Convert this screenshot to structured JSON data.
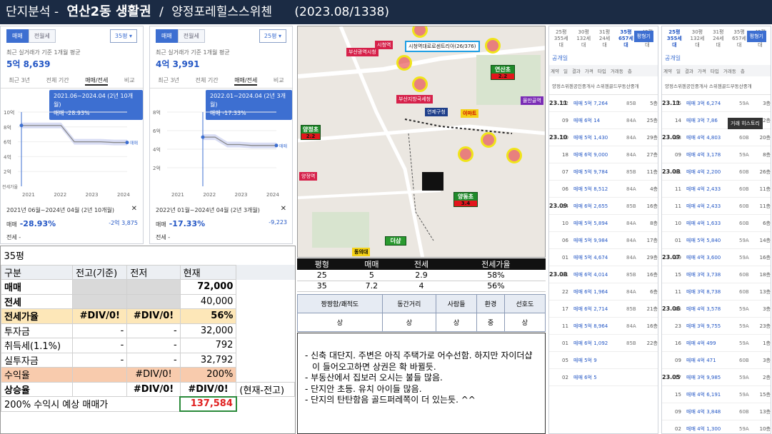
{
  "title": {
    "part1": "단지분석 -",
    "dong": "연산2동 생활권",
    "slash": "/",
    "complex": "양정포레힐스스위첸",
    "period": "(2023.08/1338)"
  },
  "cards": [
    {
      "tab1": "매매",
      "tab2": "전월세",
      "pyeong": "35평",
      "basis": "최근 실거래가 기준 1개월 평균",
      "price": "5억 8,639",
      "ptabs": [
        "최근 3년",
        "전체 기간",
        "매매/전세",
        "비교"
      ],
      "tip_line1": "2021.06~2024.04 (2년 10개월)",
      "tip_line2": "매매 -28.93%",
      "yticks": [
        "10억",
        "8억",
        "6억",
        "4억",
        "2억"
      ],
      "xticks": [
        "2021",
        "2022",
        "2023",
        "2024"
      ],
      "legend": "매매",
      "axis_note": "전세가율",
      "period": "2021년 06월~2024년 04월 (2년 10개월)",
      "close": "✕",
      "sale_label": "매매",
      "sale_pct": "-28.93%",
      "sale_amt": "-2억 3,875",
      "jeonse_label": "전세",
      "jeonse_val": "-"
    },
    {
      "tab1": "매매",
      "tab2": "전월세",
      "pyeong": "25평",
      "basis": "최근 실거래가 기준 1개월 평균",
      "price": "4억 3,991",
      "ptabs": [
        "최근 3년",
        "전체 기간",
        "매매/전세",
        "비교"
      ],
      "tip_line1": "2022.01~2024.04 (2년 3개월)",
      "tip_line2": "매매 -17.33%",
      "yticks": [
        "8억",
        "6억",
        "4억",
        "2억"
      ],
      "xticks": [
        "2021",
        "2022",
        "2023",
        "2024"
      ],
      "legend": "매매",
      "axis_note": "",
      "period": "2022년 01월~2024년 04월 (2년 3개월)",
      "close": "✕",
      "sale_label": "매매",
      "sale_pct": "-17.33%",
      "sale_amt": "-9,223",
      "jeonse_label": "전세",
      "jeonse_val": "-"
    }
  ],
  "chart_data": [
    {
      "type": "line",
      "title": "",
      "xlabel": "",
      "ylabel": "",
      "x": [
        "2021.06",
        "2021.09",
        "2022.01",
        "2022.06",
        "2022.09",
        "2023.01",
        "2023.06",
        "2024.01",
        "2024.04"
      ],
      "series": [
        {
          "name": "매매",
          "values": [
            8.2,
            8.2,
            8.2,
            8.2,
            6.0,
            6.0,
            6.0,
            5.9,
            5.9
          ]
        }
      ],
      "ylim": [
        0,
        10
      ]
    },
    {
      "type": "line",
      "title": "",
      "xlabel": "",
      "ylabel": "",
      "x": [
        "2022.01",
        "2022.06",
        "2022.09",
        "2023.01",
        "2023.06",
        "2024.01",
        "2024.04"
      ],
      "series": [
        {
          "name": "매매",
          "values": [
            5.3,
            5.3,
            4.5,
            4.5,
            4.4,
            4.4,
            4.4
          ]
        }
      ],
      "ylim": [
        0,
        8
      ]
    }
  ],
  "map": {
    "labels": [
      "시청역",
      "시청역대로로센트리아(26/376)",
      "부산광역시청",
      "부산지방국세청",
      "연제구청",
      "이마트",
      "연산초",
      "물만골역",
      "양정초",
      "양정역",
      "양동초",
      "동의대",
      "더샵"
    ],
    "green_sub": [
      "2.2",
      "2.2",
      "3.4"
    ]
  },
  "calc": {
    "pyeong": "35평",
    "headers": [
      "구분",
      "전고(기준)",
      "전저",
      "현재"
    ],
    "rows": [
      {
        "label": "매매",
        "c1": "",
        "c2": "",
        "c3": "72,000"
      },
      {
        "label": "전세",
        "c1": "",
        "c2": "",
        "c3": "40,000"
      },
      {
        "label": "전세가율",
        "c1": "#DIV/0!",
        "c2": "#DIV/0!",
        "c3": "56%"
      },
      {
        "label": "투자금",
        "c1": "-",
        "c2": "-",
        "c3": "32,000"
      },
      {
        "label": "취득세(1.1%)",
        "c1": "-",
        "c2": "-",
        "c3": "792"
      },
      {
        "label": "실투자금",
        "c1": "-",
        "c2": "-",
        "c3": "32,792"
      },
      {
        "label": "수익율",
        "c1": "",
        "c2": "#DIV/0!",
        "c3": "200%"
      },
      {
        "label": "상승율",
        "c1": "",
        "c2": "#DIV/0!",
        "c3": "#DIV/0!",
        "note": "(현재-전고)"
      }
    ],
    "target_label": "200% 수익시 예상 매매가",
    "target_value": "137,584"
  },
  "summary": {
    "headers": [
      "평형",
      "매매",
      "전세",
      "전세가율"
    ],
    "rows": [
      [
        "25",
        "5",
        "2.9",
        "58%"
      ],
      [
        "35",
        "7.2",
        "4",
        "56%"
      ]
    ]
  },
  "ratings": {
    "headers": [
      "짱짱함/쾌적도",
      "동간거리",
      "사람들",
      "환경",
      "선호도"
    ],
    "values": [
      "상",
      "상",
      "상",
      "중",
      "상"
    ]
  },
  "notes": [
    "- 신축 대단지. 주변은 아직 주택가로 어수선함. 하지만 자이더샵이 들어오고하면 상권은 확 바뀔듯.",
    "- 부동산에서 집보러 오시는 불들 많음.",
    "- 단지안 초등. 유치 아이들 많음.",
    "- 단지의 탄탄함음 골드퍼레쪽이 더 있는듯. ^^"
  ],
  "trades_a": {
    "tabs": [
      {
        "p": "25평",
        "n": "355세대"
      },
      {
        "p": "30평",
        "n": "132세대"
      },
      {
        "p": "31평",
        "n": "24세대"
      },
      {
        "p": "35평",
        "n": "657세대"
      },
      {
        "p": "42평",
        "n": "84세대"
      }
    ],
    "button": "평형기",
    "sub": "공개일",
    "cols": [
      "계약",
      "일",
      "결과",
      "가격",
      "타입",
      "거래동",
      "층"
    ],
    "agents": "양정스위첸공인중개사  스위첸골드부동산중개",
    "rows": [
      {
        "d": "23.11",
        "dd": "12",
        "p": "매매 5억 7,264",
        "t": "85B",
        "f": "5층"
      },
      {
        "d": "",
        "dd": "09",
        "p": "매매 6억 14",
        "t": "84A",
        "f": "25층"
      },
      {
        "d": "23.10",
        "dd": "30",
        "p": "매매 5억 1,430",
        "t": "84A",
        "f": "29층"
      },
      {
        "d": "",
        "dd": "18",
        "p": "매매 6억 9,000",
        "t": "84A",
        "f": "27층"
      },
      {
        "d": "",
        "dd": "07",
        "p": "매매 5억 9,784",
        "t": "85B",
        "f": "11층"
      },
      {
        "d": "",
        "dd": "06",
        "p": "매매 5억 8,512",
        "t": "84A",
        "f": "4층"
      },
      {
        "d": "23.09",
        "dd": "14",
        "p": "매매 6억 2,655",
        "t": "85B",
        "f": "16층"
      },
      {
        "d": "",
        "dd": "10",
        "p": "매매 5억 5,894",
        "t": "84A",
        "f": "8층"
      },
      {
        "d": "",
        "dd": "06",
        "p": "매매 5억 9,984",
        "t": "84A",
        "f": "17층"
      },
      {
        "d": "",
        "dd": "01",
        "p": "매매 5억 4,674",
        "t": "84A",
        "f": "29층"
      },
      {
        "d": "23.08",
        "dd": "31",
        "p": "매매 6억 4,014",
        "t": "85B",
        "f": "16층"
      },
      {
        "d": "",
        "dd": "22",
        "p": "매매 6억 1,964",
        "t": "84A",
        "f": "6층"
      },
      {
        "d": "",
        "dd": "17",
        "p": "매매 6억 2,714",
        "t": "85B",
        "f": "21층"
      },
      {
        "d": "",
        "dd": "11",
        "p": "매매 5억 8,964",
        "t": "84A",
        "f": "16층"
      },
      {
        "d": "",
        "dd": "01",
        "p": "매매 6억 1,092",
        "t": "85B",
        "f": "22층"
      },
      {
        "d": "",
        "dd": "05",
        "p": "매매 5억 9",
        "t": "",
        "f": ""
      },
      {
        "d": "",
        "dd": "02",
        "p": "매매 6억 5",
        "t": "",
        "f": ""
      }
    ]
  },
  "trades_b": {
    "tabs": [
      {
        "p": "25평",
        "n": "355세대"
      },
      {
        "p": "30평",
        "n": "132세대"
      },
      {
        "p": "31평",
        "n": "24세대"
      },
      {
        "p": "35평",
        "n": "657세대"
      },
      {
        "p": "42평",
        "n": "84세대"
      }
    ],
    "button": "평형기",
    "sub": "공개일",
    "cols": [
      "계약",
      "일",
      "결과",
      "가격",
      "타입",
      "거래동",
      "층"
    ],
    "agents": "양정스위첸공인중개사  스위첸골드부동산중개",
    "tooltip": "거래 히스토리",
    "rows": [
      {
        "d": "23.11",
        "dd": "15",
        "p": "매매 3억 6,274",
        "t": "59A",
        "f": "3층"
      },
      {
        "d": "",
        "dd": "14",
        "p": "매매 3억 7,86",
        "t": "",
        "f": "2층"
      },
      {
        "d": "23.09",
        "dd": "23",
        "p": "매매 4억 4,803",
        "t": "60B",
        "f": "20층"
      },
      {
        "d": "",
        "dd": "09",
        "p": "매매 4억 3,178",
        "t": "59A",
        "f": "8층"
      },
      {
        "d": "23.08",
        "dd": "31",
        "p": "매매 4억 2,200",
        "t": "60B",
        "f": "26층"
      },
      {
        "d": "",
        "dd": "11",
        "p": "매매 4억 2,433",
        "t": "60B",
        "f": "11층"
      },
      {
        "d": "",
        "dd": "11",
        "p": "매매 4억 2,433",
        "t": "60B",
        "f": "11층"
      },
      {
        "d": "",
        "dd": "10",
        "p": "매매 4억 1,633",
        "t": "60B",
        "f": "6층"
      },
      {
        "d": "",
        "dd": "01",
        "p": "매매 5억 5,840",
        "t": "59A",
        "f": "14층"
      },
      {
        "d": "23.07",
        "dd": "29",
        "p": "매매 4억 3,600",
        "t": "59A",
        "f": "16층"
      },
      {
        "d": "",
        "dd": "15",
        "p": "매매 3억 3,738",
        "t": "60B",
        "f": "18층"
      },
      {
        "d": "",
        "dd": "11",
        "p": "매매 3억 8,738",
        "t": "60B",
        "f": "13층"
      },
      {
        "d": "23.06",
        "dd": "25",
        "p": "매매 4억 3,578",
        "t": "59A",
        "f": "3층"
      },
      {
        "d": "",
        "dd": "23",
        "p": "매매 3억 9,755",
        "t": "59A",
        "f": "23층"
      },
      {
        "d": "",
        "dd": "16",
        "p": "매매 4억 499",
        "t": "59A",
        "f": "1층"
      },
      {
        "d": "",
        "dd": "09",
        "p": "매매 4억 471",
        "t": "60B",
        "f": "3층"
      },
      {
        "d": "23.05",
        "dd": "17",
        "p": "매매 3억 9,985",
        "t": "59A",
        "f": "2층"
      },
      {
        "d": "",
        "dd": "15",
        "p": "매매 4억 6,191",
        "t": "59A",
        "f": "15층"
      },
      {
        "d": "",
        "dd": "09",
        "p": "매매 4억 3,848",
        "t": "60B",
        "f": "13층"
      },
      {
        "d": "",
        "dd": "02",
        "p": "매매 4억 1,300",
        "t": "59A",
        "f": "10층"
      }
    ]
  }
}
